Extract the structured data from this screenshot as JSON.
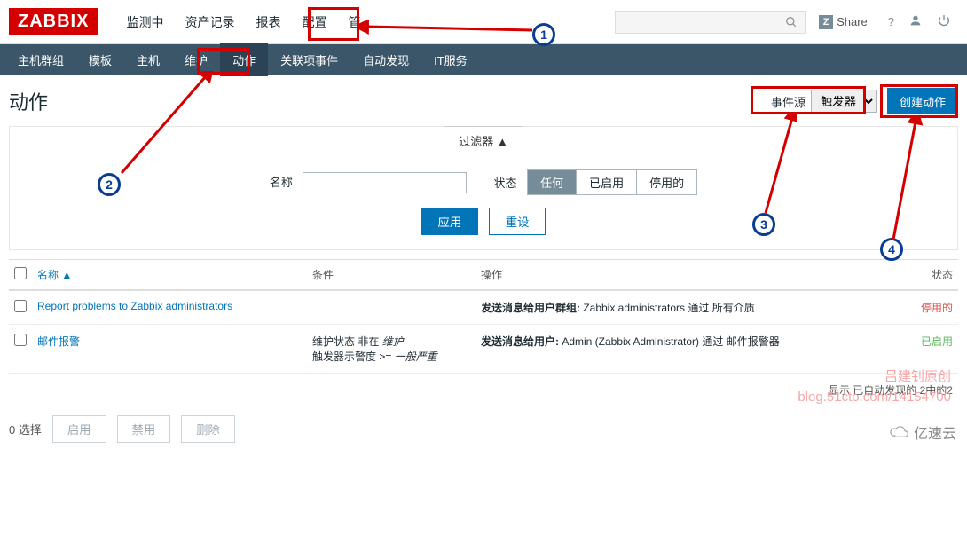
{
  "logo": "ZABBIX",
  "topmenu": [
    "监测中",
    "资产记录",
    "报表",
    "配置",
    "管"
  ],
  "share": "Share",
  "subnav": [
    "主机群组",
    "模板",
    "主机",
    "维护",
    "动作",
    "关联项事件",
    "自动发现",
    "IT服务"
  ],
  "subnav_active": "动作",
  "page_title": "动作",
  "event_source": {
    "label": "事件源",
    "value": "触发器"
  },
  "create_btn": "创建动作",
  "filter": {
    "tab": "过滤器 ▲",
    "name_label": "名称",
    "status_label": "状态",
    "status_opts": [
      "任何",
      "已启用",
      "停用的"
    ],
    "apply": "应用",
    "reset": "重设"
  },
  "table": {
    "headers": {
      "name": "名称 ▲",
      "cond": "条件",
      "op": "操作",
      "status": "状态"
    },
    "rows": [
      {
        "name": "Report problems to Zabbix administrators",
        "cond": "",
        "op_b": "发送消息给用户群组:",
        "op": " Zabbix administrators 通过 所有介质",
        "status": "停用的",
        "st_cls": "st-dis"
      },
      {
        "name": "邮件报警",
        "cond": "维护状态 非在 维护\n触发器示警度 >= 一般严重",
        "op_b": "发送消息给用户:",
        "op": " Admin (Zabbix Administrator) 通过 邮件报警器",
        "status": "已启用",
        "st_cls": "st-en"
      }
    ]
  },
  "summary": "显示 已自动发现的 2中的2",
  "footer": {
    "selected": "0 选择",
    "enable": "启用",
    "disable": "禁用",
    "delete": "删除"
  },
  "watermark": {
    "l1": "吕建钊原创",
    "l2": "blog.51cto.com/14154700",
    "brand": "亿速云"
  }
}
